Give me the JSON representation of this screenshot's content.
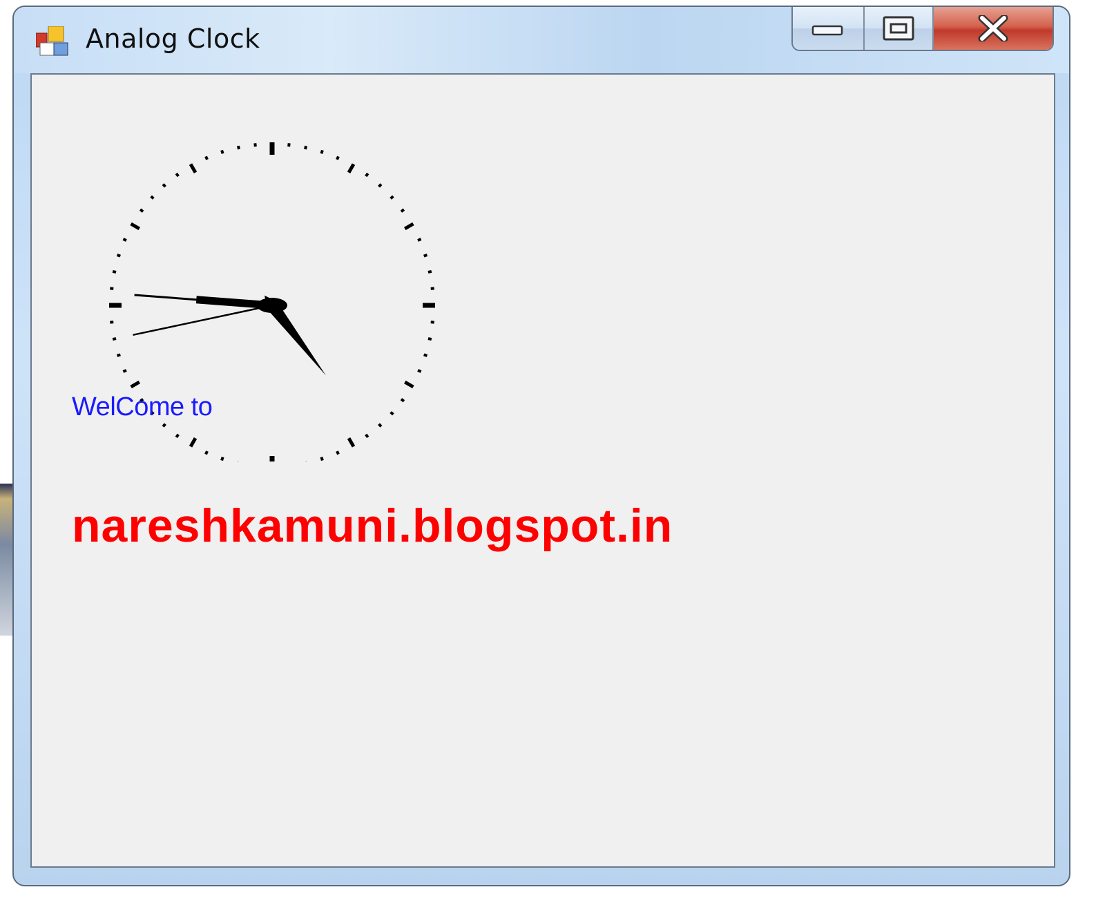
{
  "window": {
    "title": "Analog Clock",
    "icon": "winforms-app-icon",
    "buttons": {
      "minimize": "minimize-icon",
      "maximize": "maximize-icon",
      "close": "close-icon"
    }
  },
  "client": {
    "welcome_text": "WelCome to",
    "blog_text": "nareshkamuni.blogspot.in",
    "clock": {
      "hour": 4,
      "minute": 45,
      "second": 43
    }
  },
  "colors": {
    "welcome": "#1a1aff",
    "blog": "#ff0000",
    "client_bg": "#f0f0f0"
  }
}
